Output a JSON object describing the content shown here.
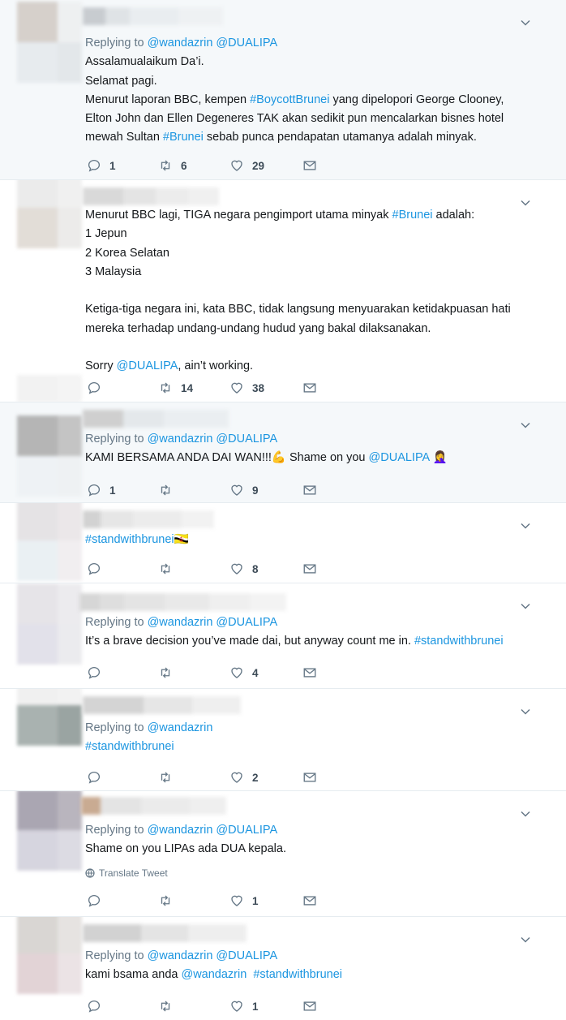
{
  "colors": {
    "link": "#1b95e0",
    "meta": "#657786",
    "highlight_bg": "#f5f8fa",
    "divider": "#e6ecf0"
  },
  "tweets": [
    {
      "reply_prefix": "Replying to",
      "reply_to": [
        "@wandazrin",
        "@DUALIPA"
      ],
      "lines": [
        [
          "Assalamualaikum Da’i."
        ],
        [
          "Selamat pagi."
        ],
        [
          "Menurut laporan BBC, kempen ",
          "#BoycottBrunei",
          " yang dipelopori George Clooney,"
        ],
        [
          "Elton John dan Ellen Degeneres TAK akan sedikit pun mencalarkan bisnes hotel"
        ],
        [
          "mewah Sultan ",
          "#Brunei",
          " sebab punca pendapatan utamanya adalah minyak."
        ]
      ],
      "reply_count": "1",
      "retweet_count": "6",
      "like_count": "29"
    },
    {
      "reply_prefix": "",
      "reply_to": [],
      "lines": [
        [
          "Menurut BBC lagi, TIGA negara pengimport utama minyak ",
          "#Brunei",
          " adalah:"
        ],
        [
          "1 Jepun"
        ],
        [
          "2 Korea Selatan"
        ],
        [
          "3 Malaysia"
        ],
        [
          ""
        ],
        [
          "Ketiga-tiga negara ini, kata BBC, tidak langsung menyuarakan ketidakpuasan hati"
        ],
        [
          "mereka terhadap undang-undang hudud yang bakal dilaksanakan."
        ],
        [
          ""
        ],
        [
          "Sorry ",
          "@DUALIPA",
          ", ain’t working."
        ]
      ],
      "reply_count": "",
      "retweet_count": "14",
      "like_count": "38"
    },
    {
      "reply_prefix": "Replying to",
      "reply_to": [
        "@wandazrin",
        "@DUALIPA"
      ],
      "lines": [
        [
          "KAMI BERSAMA ANDA DAI WAN!!!💪 Shame on you ",
          "@DUALIPA",
          " 🤦‍♀️"
        ]
      ],
      "reply_count": "1",
      "retweet_count": "",
      "like_count": "9"
    },
    {
      "reply_prefix": "",
      "reply_to": [],
      "lines": [
        [
          "",
          "#standwithbrunei",
          "🇧🇳"
        ]
      ],
      "reply_count": "",
      "retweet_count": "",
      "like_count": "8"
    },
    {
      "reply_prefix": "Replying to",
      "reply_to": [
        "@wandazrin",
        "@DUALIPA"
      ],
      "lines": [
        [
          "It’s a brave decision you’ve made dai, but anyway count me in. ",
          "#standwithbrunei",
          ""
        ]
      ],
      "reply_count": "",
      "retweet_count": "",
      "like_count": "4"
    },
    {
      "reply_prefix": "Replying to",
      "reply_to": [
        "@wandazrin"
      ],
      "lines": [
        [
          "",
          "#standwithbrunei",
          ""
        ]
      ],
      "reply_count": "",
      "retweet_count": "",
      "like_count": "2"
    },
    {
      "reply_prefix": "Replying to",
      "reply_to": [
        "@wandazrin",
        "@DUALIPA"
      ],
      "lines": [
        [
          "Shame on you LIPAs ada DUA kepala."
        ]
      ],
      "translate_label": "Translate Tweet",
      "reply_count": "",
      "retweet_count": "",
      "like_count": "1"
    },
    {
      "reply_prefix": "Replying to",
      "reply_to": [
        "@wandazrin",
        "@DUALIPA"
      ],
      "lines": [
        [
          "kami bsama anda ",
          "@wandazrin",
          "  ",
          "#standwithbrunei",
          ""
        ]
      ],
      "reply_count": "",
      "retweet_count": "",
      "like_count": "1"
    }
  ]
}
